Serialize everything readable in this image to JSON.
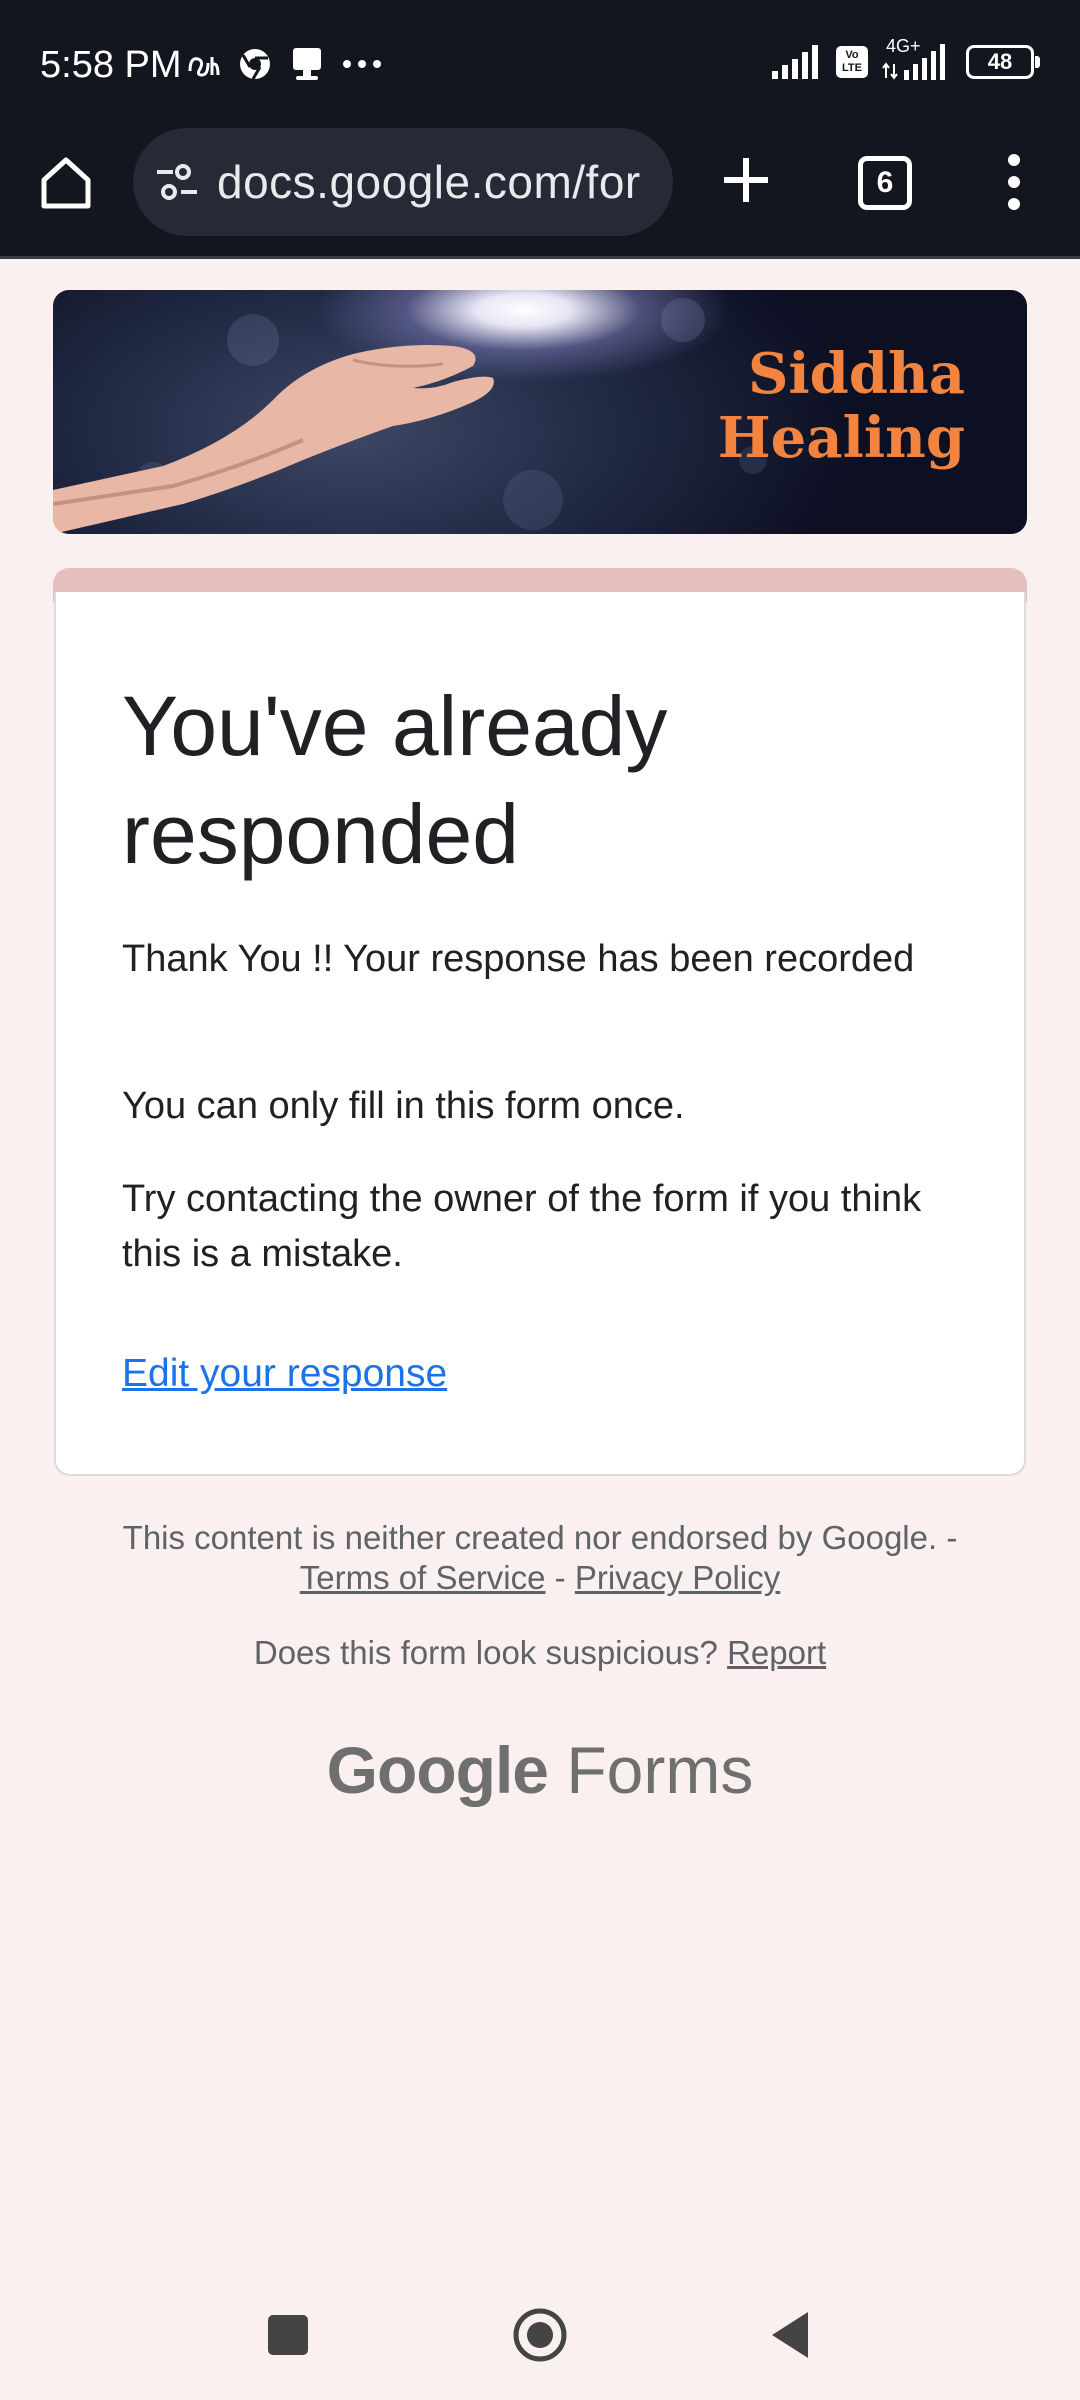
{
  "status_bar": {
    "time": "5:58 PM",
    "network": "4G+",
    "volte": "Vo LTE",
    "battery": "48"
  },
  "browser": {
    "url": "docs.google.com/for",
    "tab_count": "6"
  },
  "banner": {
    "title_line1": "Siddha",
    "title_line2": "Healing",
    "accent_color": "#f3843f"
  },
  "form": {
    "heading": "You've already responded",
    "messages": [
      "Thank You !! Your response has been recorded",
      "You can only fill in this form once.",
      "Try contacting the owner of the form if you think this is a mistake."
    ],
    "edit_link": "Edit your response",
    "link_color": "#1a73e8"
  },
  "footer": {
    "disclaimer": "This content is neither created nor endorsed by Google. -",
    "terms": "Terms of Service",
    "separator": "-",
    "privacy": "Privacy Policy",
    "suspicious": "Does this form look suspicious?",
    "report": "Report",
    "brand_google": "Google",
    "brand_forms": "Forms"
  },
  "icons": {
    "home": "home-icon",
    "site_settings": "tune-icon",
    "new_tab": "plus-icon",
    "tabs": "tab-switcher-icon",
    "menu": "more-vert-icon",
    "nav_recents": "square-icon",
    "nav_home": "circle-icon",
    "nav_back": "triangle-back-icon"
  }
}
